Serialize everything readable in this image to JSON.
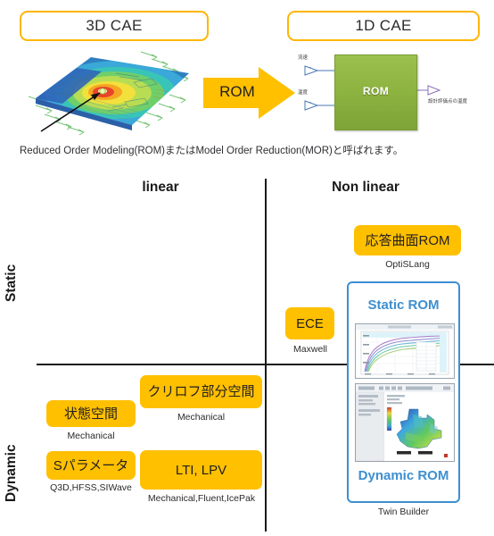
{
  "header": {
    "left_pill": "3D CAE",
    "right_pill": "1D CAE"
  },
  "transform_arrow": {
    "label": "ROM",
    "color": "#ffc000"
  },
  "rom_diagram": {
    "block_label": "ROM",
    "block_color": "#8bb13f",
    "input_1": "流速",
    "input_2": "温度",
    "output_1": "設計評価点の温度"
  },
  "caption": "Reduced Order Modeling(ROM)またはModel Order Reduction(MOR)と呼ばれます。",
  "matrix": {
    "column_headers": [
      "linear",
      "Non linear"
    ],
    "row_headers": [
      "Static",
      "Dynamic"
    ],
    "chips": [
      {
        "id": "rsrom",
        "label": "応答曲面ROM",
        "product": "OptiSLang",
        "quadrant": "static-nonlinear"
      },
      {
        "id": "ece",
        "label": "ECE",
        "product": "Maxwell",
        "quadrant": "static-nonlinear"
      },
      {
        "id": "krylov",
        "label": "クリロフ部分空間",
        "product": "Mechanical",
        "quadrant": "dynamic-linear"
      },
      {
        "id": "state",
        "label": "状態空間",
        "product": "Mechanical",
        "quadrant": "dynamic-linear"
      },
      {
        "id": "sparam",
        "label": "Sパラメータ",
        "product": "Q3D,HFSS,SIWave",
        "quadrant": "dynamic-linear"
      },
      {
        "id": "lti",
        "label": "LTI, LPV",
        "product": "Mechanical,Fluent,IcePak",
        "quadrant": "dynamic-linear"
      }
    ],
    "chip_color": "#ffc000",
    "panel": {
      "top_title": "Static ROM",
      "bottom_title": "Dynamic ROM",
      "product": "Twin Builder",
      "border_color": "#3d8fd1"
    }
  }
}
